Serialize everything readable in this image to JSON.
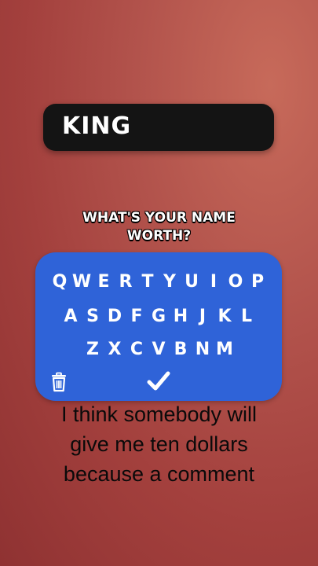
{
  "name_box": {
    "value": "KING"
  },
  "prompt": {
    "line1": "WHAT'S YOUR NAME",
    "line2": "WORTH?"
  },
  "keyboard": {
    "row1": [
      "Q",
      "W",
      "E",
      "R",
      "T",
      "Y",
      "U",
      "I",
      "O",
      "P"
    ],
    "row2": [
      "A",
      "S",
      "D",
      "F",
      "G",
      "H",
      "J",
      "K",
      "L"
    ],
    "row3": [
      "Z",
      "X",
      "C",
      "V",
      "B",
      "N",
      "M"
    ],
    "delete_icon": "trash-icon",
    "submit_icon": "checkmark-icon",
    "colors": {
      "background": "#2f63d8",
      "keys": "#ffffff"
    }
  },
  "caption": {
    "line1": "I think somebody will",
    "line2": "give me ten dollars",
    "line3": "because a comment"
  }
}
